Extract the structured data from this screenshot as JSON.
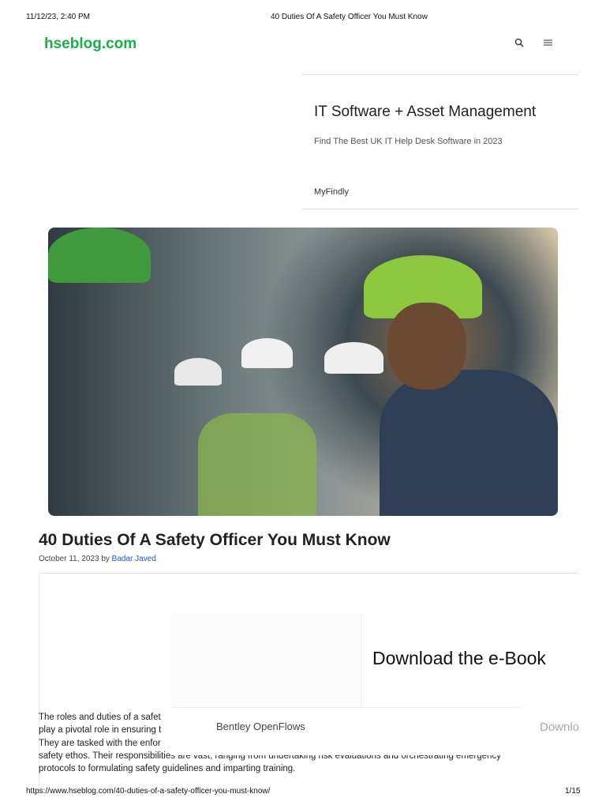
{
  "print_header": {
    "datetime": "11/12/23, 2:40 PM",
    "page_title": "40 Duties Of A Safety Officer You Must Know"
  },
  "site": {
    "logo": "hseblog.com",
    "search_icon": "search-icon",
    "menu_icon": "menu-icon",
    "brand_color": "#1aae4a"
  },
  "ad_top": {
    "title": "IT Software + Asset Management",
    "subtitle": "Find The Best UK IT Help Desk Software in 2023",
    "brand": "MyFindly"
  },
  "article": {
    "title": "40 Duties Of A Safety Officer You Must Know",
    "date": "October 11, 2023",
    "by": "by",
    "author": "Badar Javed",
    "body_lines": [
      "The roles and duties of a safet",
      "play a pivotal role in ensuring t",
      "They are tasked with the enfor",
      "safety ethos. Their responsibilities are vast, ranging from undertaking risk evaluations and orchestrating emergency",
      "protocols to formulating safety guidelines and imparting training."
    ]
  },
  "ad_overlay": {
    "headline": "Download the e-Book",
    "brand": "Bentley OpenFlows",
    "cta": "Downlo"
  },
  "print_footer": {
    "url": "https://www.hseblog.com/40-duties-of-a-safety-officer-you-must-know/",
    "page": "1/15"
  }
}
